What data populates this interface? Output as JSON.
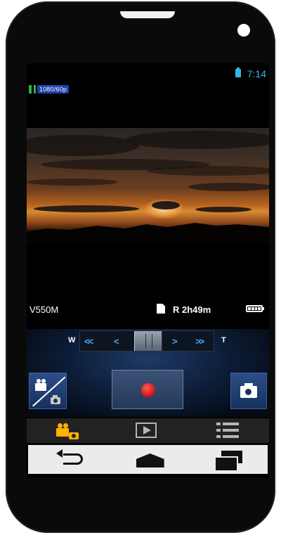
{
  "status_bar": {
    "time": "7:14",
    "battery_color": "#35b7e6"
  },
  "recording": {
    "mode_badge": "1080/60p"
  },
  "info": {
    "model": "V550M",
    "remaining": "R 2h49m"
  },
  "zoom": {
    "wide_label": "W",
    "tele_label": "T",
    "fast_wide": "<<",
    "wide": "<",
    "tele": ">",
    "fast_tele": ">>",
    "accent_color": "#4aa6ff"
  },
  "controls": {
    "mode_toggle_icon": "movie-photo-toggle-icon",
    "record_icon": "record-dot-icon",
    "record_color": "#e01414",
    "photo_icon": "camera-icon"
  },
  "tabs": [
    {
      "icon": "movie-photo-icon",
      "active": true,
      "color": "#ffb200"
    },
    {
      "icon": "playback-icon",
      "active": false
    },
    {
      "icon": "menu-list-icon",
      "active": false
    }
  ],
  "nav": [
    {
      "icon": "back-icon"
    },
    {
      "icon": "home-icon"
    },
    {
      "icon": "recent-apps-icon"
    }
  ]
}
